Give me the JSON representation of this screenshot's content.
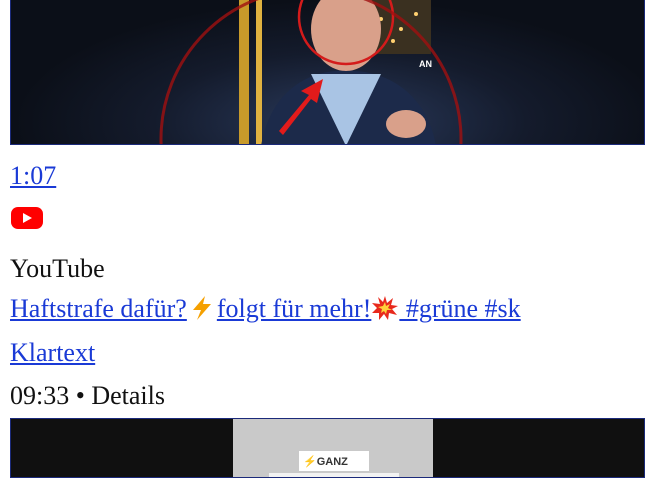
{
  "video1": {
    "thumbnail_label": "AN",
    "duration": "1:07",
    "source_icon": "youtube-icon",
    "source": "YouTube",
    "title_parts": [
      "Haftstrafe dafür?",
      "folgt für mehr!",
      " #grüne #sk"
    ],
    "title_icons": [
      "lightning-icon",
      "collision-icon"
    ],
    "channel": "Klartext",
    "meta": "09:33 • Details"
  },
  "video2": {
    "thumbnail_label": "⚡GANZ"
  },
  "colors": {
    "link": "#1a3ad6",
    "youtube_red": "#ff0000",
    "lightning": "#f5a000"
  }
}
